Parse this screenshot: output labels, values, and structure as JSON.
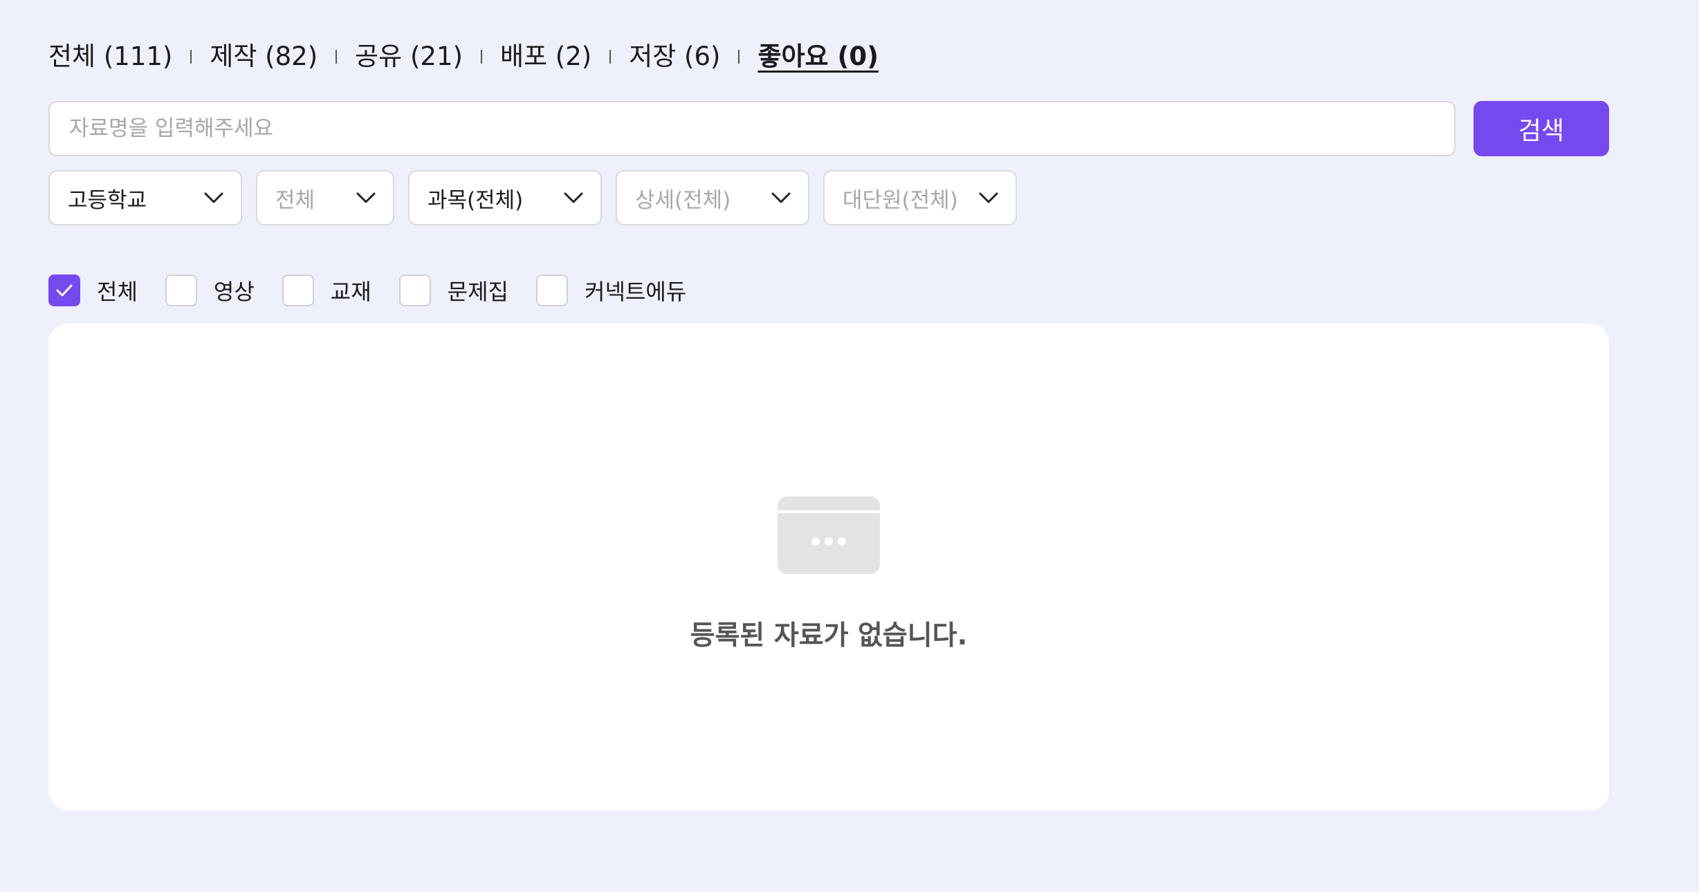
{
  "tabs": [
    {
      "label": "전체 (111)",
      "active": false
    },
    {
      "label": "제작 (82)",
      "active": false
    },
    {
      "label": "공유 (21)",
      "active": false
    },
    {
      "label": "배포 (2)",
      "active": false
    },
    {
      "label": "저장 (6)",
      "active": false
    },
    {
      "label": "좋아요 (0)",
      "active": true
    }
  ],
  "search": {
    "placeholder": "자료명을 입력해주세요",
    "value": "",
    "button_label": "검색"
  },
  "filters": [
    {
      "label": "고등학교",
      "muted": false
    },
    {
      "label": "전체",
      "muted": true
    },
    {
      "label": "과목(전체)",
      "muted": false
    },
    {
      "label": "상세(전체)",
      "muted": true
    },
    {
      "label": "대단원(전체)",
      "muted": true
    }
  ],
  "checkboxes": [
    {
      "label": "전체",
      "checked": true
    },
    {
      "label": "영상",
      "checked": false
    },
    {
      "label": "교재",
      "checked": false
    },
    {
      "label": "문제집",
      "checked": false
    },
    {
      "label": "커넥트에듀",
      "checked": false
    }
  ],
  "empty_state": {
    "icon": "empty-window-icon",
    "message": "등록된 자료가 없습니다."
  },
  "colors": {
    "accent": "#7649ee",
    "background": "#eef0fb",
    "panel": "#ffffff",
    "muted_text": "#a6a6ab"
  }
}
